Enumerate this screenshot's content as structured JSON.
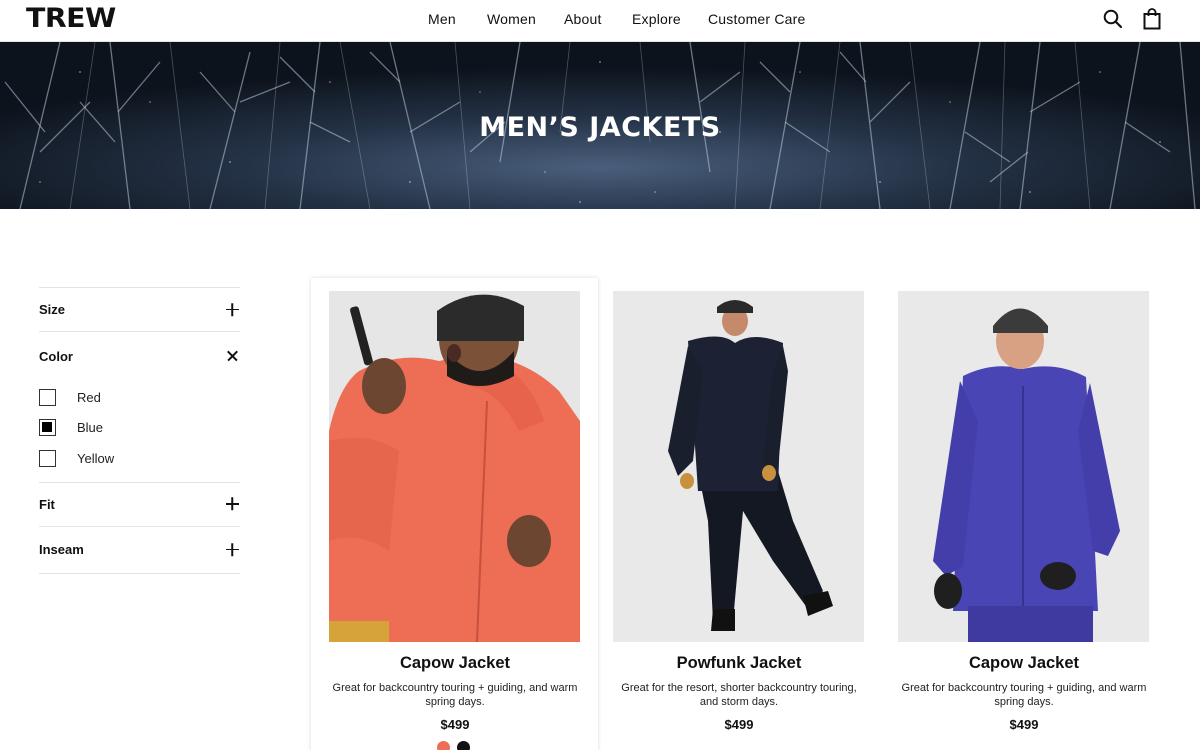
{
  "brand": {
    "logo": "TREW"
  },
  "nav": {
    "items": [
      {
        "label": "Men"
      },
      {
        "label": "Women"
      },
      {
        "label": "About"
      },
      {
        "label": "Explore"
      },
      {
        "label": "Customer Care"
      }
    ],
    "search_icon": "search-icon",
    "cart_icon": "bag-icon"
  },
  "hero": {
    "title": "MEN’S JACKETS"
  },
  "filters": {
    "size": {
      "label": "Size",
      "state": "collapsed"
    },
    "color": {
      "label": "Color",
      "state": "expanded",
      "options": [
        {
          "label": "Red",
          "checked": false
        },
        {
          "label": "Blue",
          "checked": true
        },
        {
          "label": "Yellow",
          "checked": false
        }
      ]
    },
    "fit": {
      "label": "Fit",
      "state": "collapsed"
    },
    "inseam": {
      "label": "Inseam",
      "state": "collapsed"
    }
  },
  "products": [
    {
      "name": "Capow Jacket",
      "description": "Great for backcountry touring + guiding, and warm spring days.",
      "price": "$499",
      "jacket_color": "#ee6e55",
      "swatches": [
        "#ee6e55",
        "#111111"
      ]
    },
    {
      "name": "Powfunk Jacket",
      "description": "Great for the resort, shorter backcountry touring, and storm days.",
      "price": "$499",
      "jacket_color": "#1c2233"
    },
    {
      "name": "Capow Jacket",
      "description": "Great for backcountry touring + guiding, and warm spring days.",
      "price": "$499",
      "jacket_color": "#4a45b4"
    }
  ]
}
